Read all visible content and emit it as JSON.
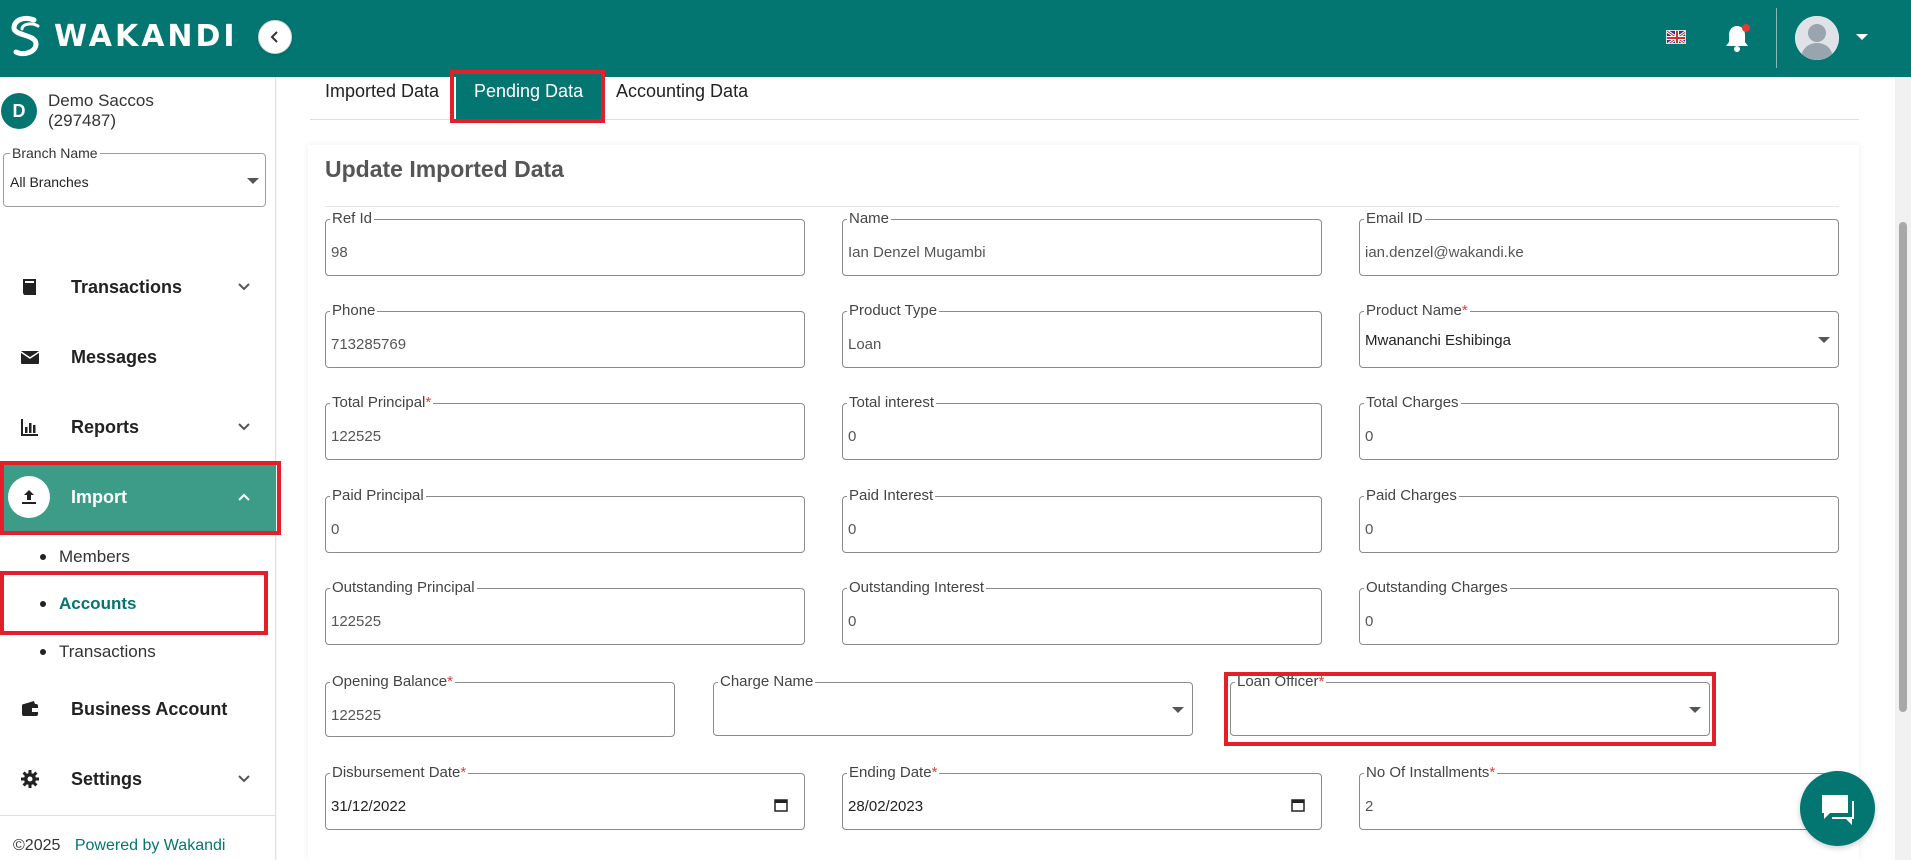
{
  "header": {
    "brand": "WAKANDI",
    "language_icon": "uk-flag-icon",
    "notification_icon": "bell-icon",
    "avatar_icon": "user-avatar-icon"
  },
  "sidebar": {
    "org_initial": "D",
    "org_name_line1": "Demo Saccos",
    "org_name_line2": "(297487)",
    "branch": {
      "label": "Branch Name",
      "value": "All Branches"
    },
    "nav": [
      {
        "label": "Transactions"
      },
      {
        "label": "Messages"
      },
      {
        "label": "Reports"
      },
      {
        "label": "Import"
      },
      {
        "label": "Business Account"
      },
      {
        "label": "Settings"
      }
    ],
    "import_sub": [
      {
        "label": "Members"
      },
      {
        "label": "Accounts"
      },
      {
        "label": "Transactions"
      }
    ],
    "footer_copy": "©2025",
    "footer_link": "Powered by Wakandi"
  },
  "tabs": [
    {
      "label": "Imported Data"
    },
    {
      "label": "Pending Data"
    },
    {
      "label": "Accounting Data"
    }
  ],
  "form": {
    "title": "Update Imported Data",
    "fields": {
      "ref_id": {
        "label": "Ref Id",
        "value": "98"
      },
      "name": {
        "label": "Name",
        "value": "Ian Denzel Mugambi"
      },
      "email": {
        "label": "Email ID",
        "value": "ian.denzel@wakandi.ke"
      },
      "phone": {
        "label": "Phone",
        "value": "713285769"
      },
      "product_type": {
        "label": "Product Type",
        "value": "Loan"
      },
      "product_name": {
        "label": "Product Name",
        "value": "Mwananchi Eshibinga"
      },
      "total_principal": {
        "label": "Total Principal",
        "value": "122525"
      },
      "total_interest": {
        "label": "Total interest",
        "value": "0"
      },
      "total_charges": {
        "label": "Total Charges",
        "value": "0"
      },
      "paid_principal": {
        "label": "Paid Principal",
        "value": "0"
      },
      "paid_interest": {
        "label": "Paid Interest",
        "value": "0"
      },
      "paid_charges": {
        "label": "Paid Charges",
        "value": "0"
      },
      "outstanding_principal": {
        "label": "Outstanding Principal",
        "value": "122525"
      },
      "outstanding_interest": {
        "label": "Outstanding Interest",
        "value": "0"
      },
      "outstanding_charges": {
        "label": "Outstanding Charges",
        "value": "0"
      },
      "opening_balance": {
        "label": "Opening Balance",
        "value": "122525"
      },
      "charge_name": {
        "label": "Charge Name",
        "value": ""
      },
      "loan_officer": {
        "label": "Loan Officer",
        "value": ""
      },
      "disbursement_date": {
        "label": "Disbursement Date",
        "value": "31/12/2022"
      },
      "ending_date": {
        "label": "Ending Date",
        "value": "28/02/2023"
      },
      "installments": {
        "label": "No Of Installments",
        "value": "2"
      }
    },
    "required_mark": "*"
  },
  "colors": {
    "brand": "#037672",
    "active_nav": "#3d9c88",
    "highlight": "#e3202a"
  }
}
